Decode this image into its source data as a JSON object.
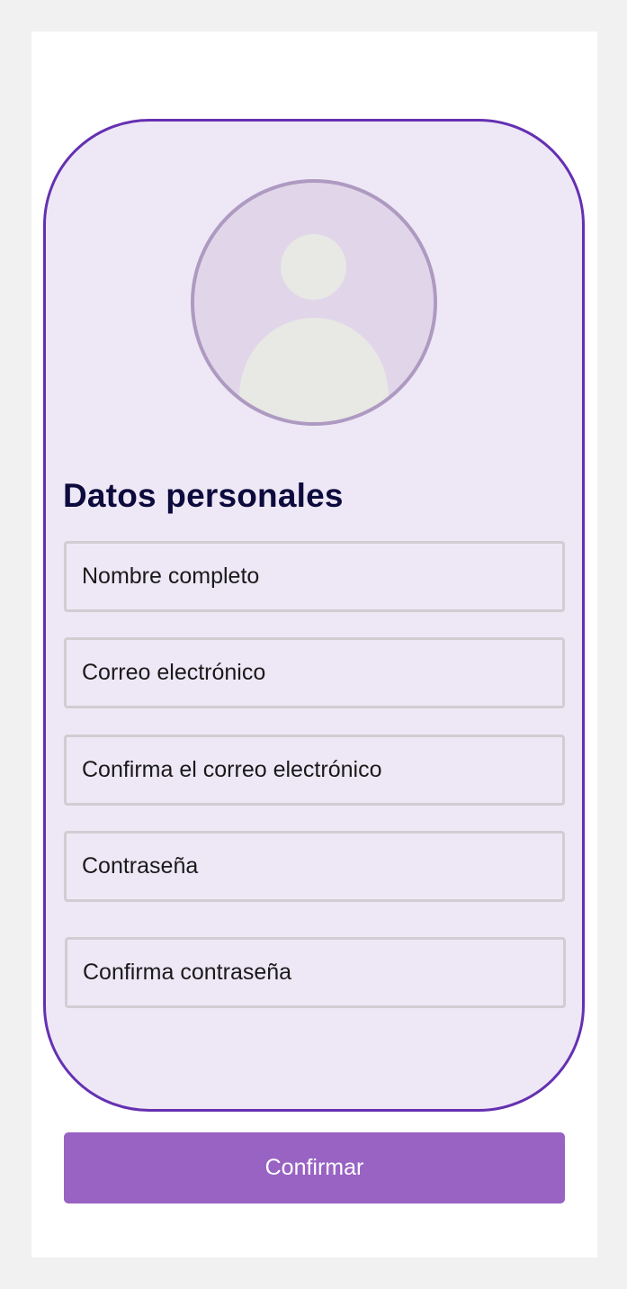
{
  "form": {
    "title": "Datos personales",
    "fields": [
      {
        "name": "full-name",
        "value": "",
        "placeholder": "Nombre completo"
      },
      {
        "name": "email",
        "value": "",
        "placeholder": "Correo electrónico"
      },
      {
        "name": "confirm-email",
        "value": "",
        "placeholder": "Confirma el correo electrónico"
      },
      {
        "name": "password",
        "value": "",
        "placeholder": "Contraseña"
      },
      {
        "name": "confirm-password",
        "value": "",
        "placeholder": "Confirma contraseña"
      }
    ],
    "confirm_label": "Confirmar"
  },
  "avatar": {
    "icon": "user-placeholder-icon"
  },
  "colors": {
    "accent": "#6530b2",
    "card_background": "#eee8f6",
    "button": "#9963c4",
    "title": "#0d0a3d",
    "page_background": "#f1f1f1"
  }
}
